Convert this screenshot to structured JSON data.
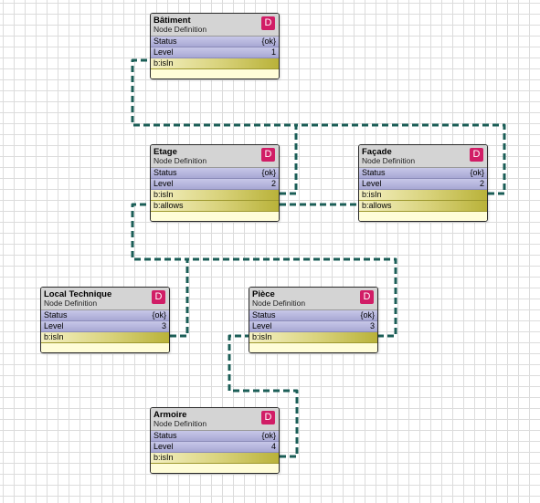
{
  "diagram": {
    "nodes": [
      {
        "id": "batiment",
        "title": "Bâtiment",
        "subtitle": "Node Definition",
        "badge": "D",
        "properties": [
          {
            "label": "Status",
            "value": "{ok}"
          },
          {
            "label": "Level",
            "value": "1"
          }
        ],
        "relations": [
          "b:isIn"
        ]
      },
      {
        "id": "etage",
        "title": "Etage",
        "subtitle": "Node Definition",
        "badge": "D",
        "properties": [
          {
            "label": "Status",
            "value": "{ok}"
          },
          {
            "label": "Level",
            "value": "2"
          }
        ],
        "relations": [
          "b:isIn",
          "b:allows"
        ]
      },
      {
        "id": "facade",
        "title": "Façade",
        "subtitle": "Node Definition",
        "badge": "D",
        "properties": [
          {
            "label": "Status",
            "value": "{ok}"
          },
          {
            "label": "Level",
            "value": "2"
          }
        ],
        "relations": [
          "b:isIn",
          "b:allows"
        ]
      },
      {
        "id": "local-technique",
        "title": "Local Technique",
        "subtitle": "Node Definition",
        "badge": "D",
        "properties": [
          {
            "label": "Status",
            "value": "{ok}"
          },
          {
            "label": "Level",
            "value": "3"
          }
        ],
        "relations": [
          "b:isIn"
        ]
      },
      {
        "id": "piece",
        "title": "Pièce",
        "subtitle": "Node Definition",
        "badge": "D",
        "properties": [
          {
            "label": "Status",
            "value": "{ok}"
          },
          {
            "label": "Level",
            "value": "3"
          }
        ],
        "relations": [
          "b:isIn"
        ]
      },
      {
        "id": "armoire",
        "title": "Armoire",
        "subtitle": "Node Definition",
        "badge": "D",
        "properties": [
          {
            "label": "Status",
            "value": "{ok}"
          },
          {
            "label": "Level",
            "value": "4"
          }
        ],
        "relations": [
          "b:isIn"
        ]
      }
    ],
    "links": [
      {
        "from": "etage",
        "from_port": "b:isIn",
        "to": "batiment",
        "to_port": "b:isIn"
      },
      {
        "from": "facade",
        "from_port": "b:isIn",
        "to": "batiment",
        "to_port": "b:isIn"
      },
      {
        "from": "etage",
        "from_port": "b:allows",
        "to": "facade",
        "to_port": "b:allows"
      },
      {
        "from": "local-technique",
        "from_port": "b:isIn",
        "to": "etage",
        "to_port": "b:allows"
      },
      {
        "from": "piece",
        "from_port": "b:isIn",
        "to": "etage",
        "to_port": "b:allows"
      },
      {
        "from": "armoire",
        "from_port": "b:isIn",
        "to": "piece",
        "to_port": "b:isIn"
      }
    ],
    "colors": {
      "link": "#1b5e57",
      "badge": "#d11d66",
      "header": "#d4d4d4",
      "property_row": "#b7b7de",
      "relation_row": "#d8d27a",
      "footer": "#fffdd8"
    }
  }
}
